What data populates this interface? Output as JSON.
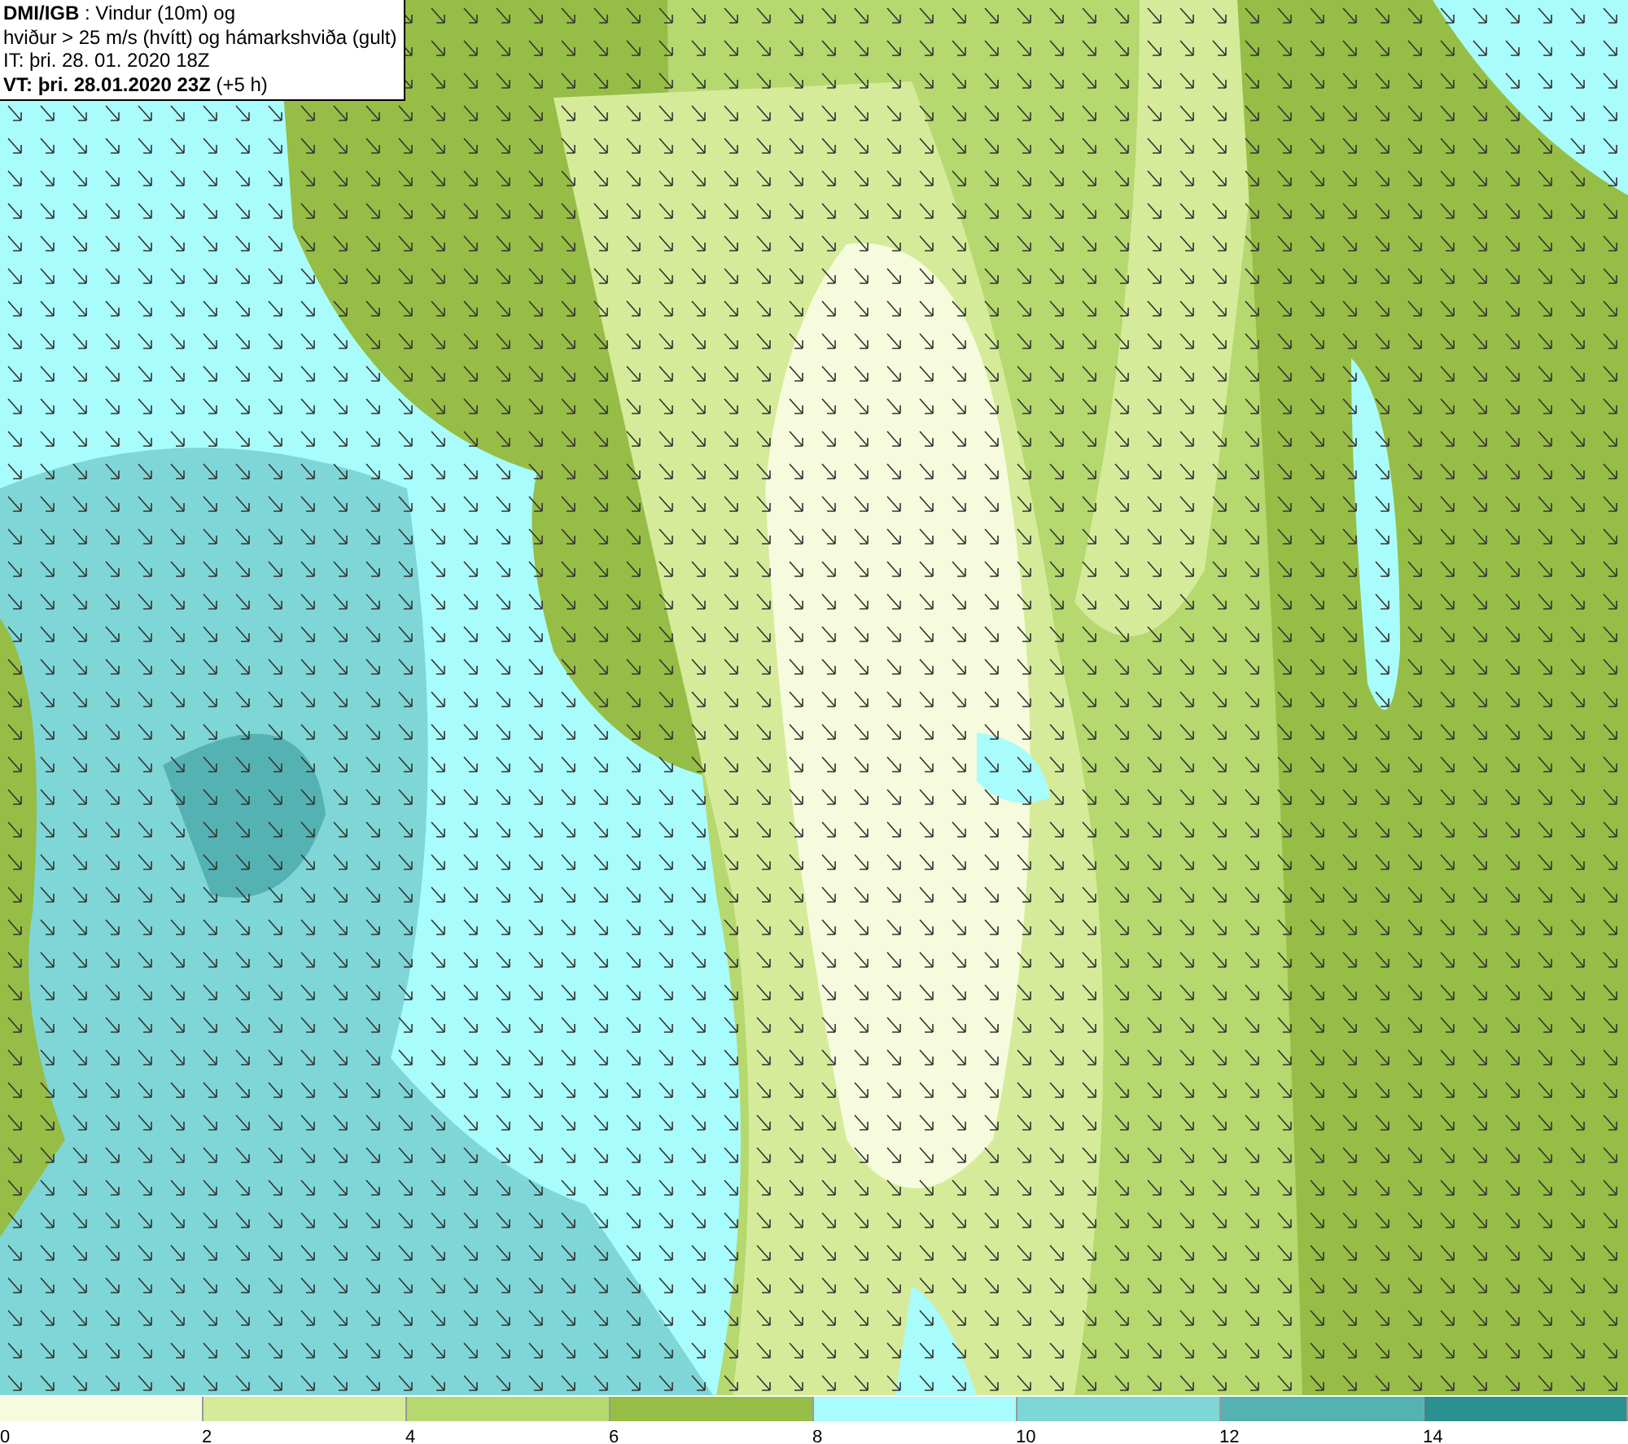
{
  "header": {
    "lines": [
      "**DMI/IGB** : Vindur (10m) og",
      "hviður > 25 m/s (hvítt) og hámarkshviða (gult)",
      "IT: þri. 28. 01. 2020 18Z",
      "**VT: þri. 28.01.2020 23Z** (+5 h)"
    ]
  },
  "legend": {
    "bins": [
      {
        "label": "0",
        "color": "#f5fbdc"
      },
      {
        "label": "2",
        "color": "#d5eb9a"
      },
      {
        "label": "4",
        "color": "#b5d86f"
      },
      {
        "label": "6",
        "color": "#96bd45"
      },
      {
        "label": "8",
        "color": "#a8fcfc"
      },
      {
        "label": "10",
        "color": "#7fd6d6"
      },
      {
        "label": "12",
        "color": "#55b2b2"
      },
      {
        "label": "14",
        "color": "#2a9090"
      }
    ]
  }
}
